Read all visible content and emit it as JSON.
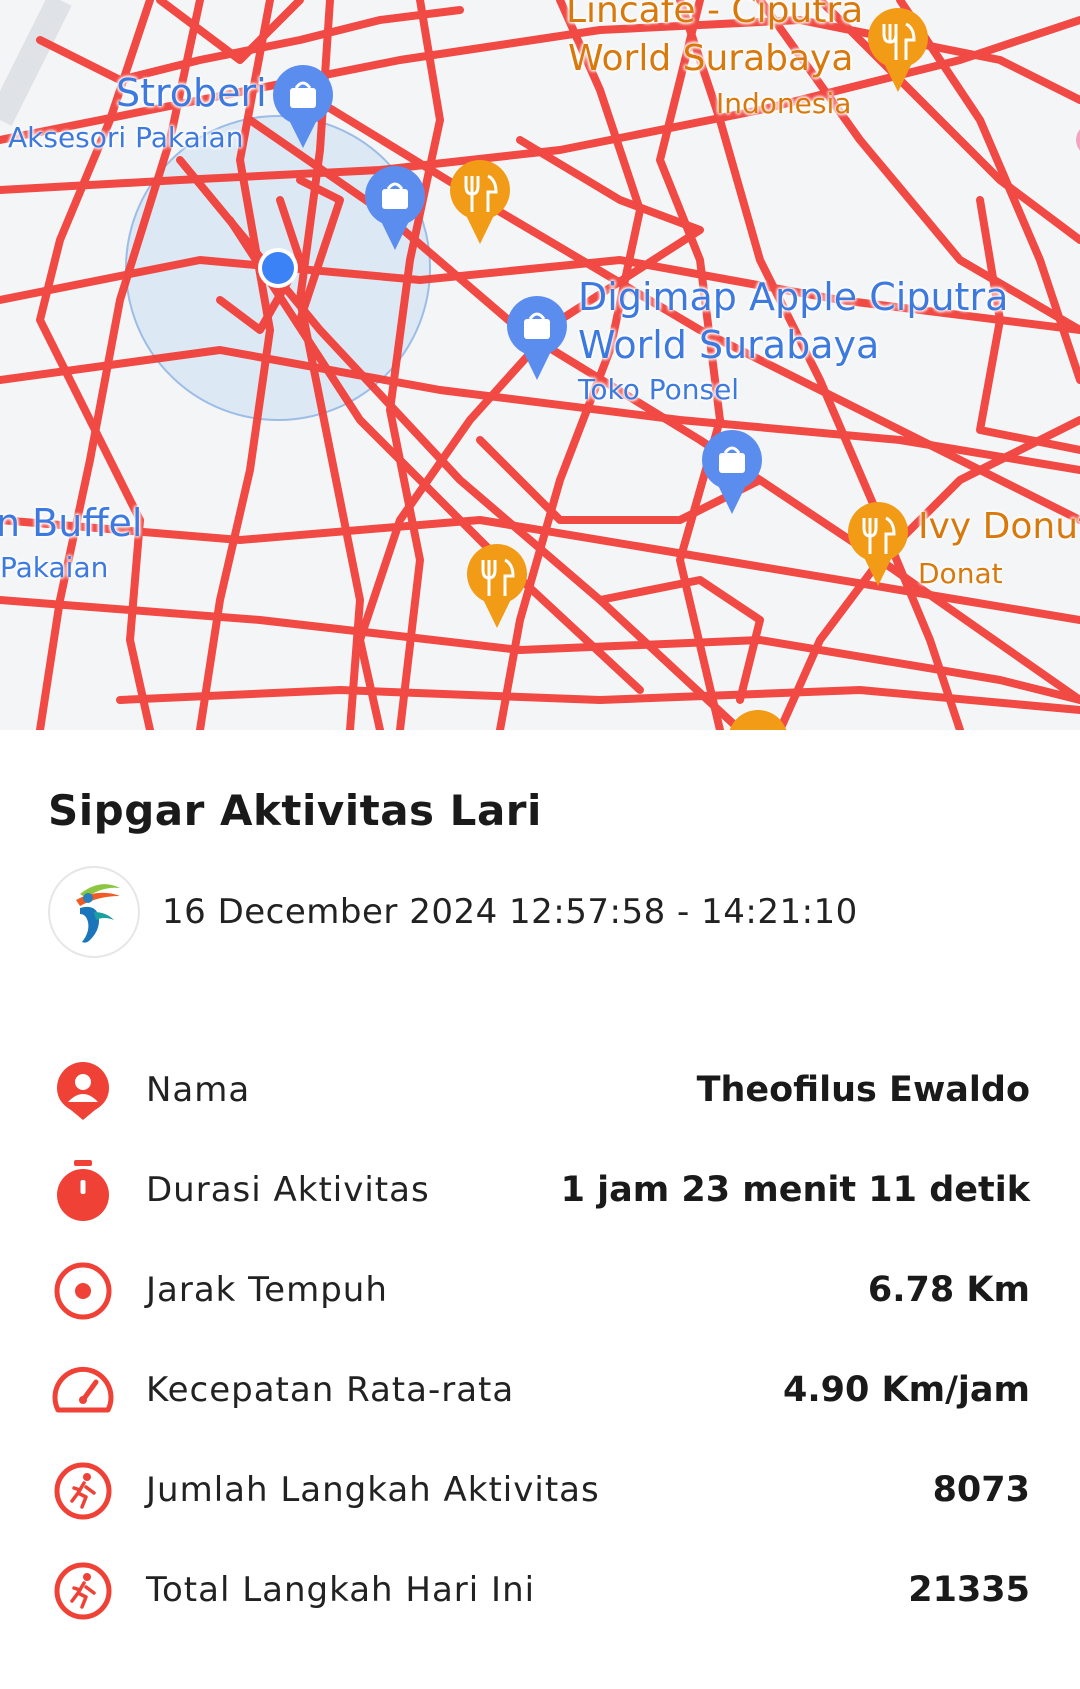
{
  "map": {
    "pois": {
      "stroberi": {
        "name": "Stroberi",
        "category": "Aksesori Pakaian"
      },
      "buffel": {
        "name": "n Buffel",
        "category": "Pakaian"
      },
      "lincafe": {
        "name_line1": "Lincafe - Ciputra",
        "name_line2": "World Surabaya",
        "category": "Indonesia"
      },
      "digimap": {
        "name_line1": "Digimap Apple Ciputra",
        "name_line2": "World Surabaya",
        "category": "Toko Ponsel"
      },
      "ivy": {
        "name": "Ivy Donut",
        "category": "Donat"
      }
    },
    "route_color": "#f1403a",
    "shop_pin_color": "#5b8def",
    "food_pin_color": "#f29b16",
    "location_dot_color": "#3b82f6"
  },
  "activity": {
    "title": "Sipgar Aktivitas Lari",
    "datetime": "16 December 2024 12:57:58 - 14:21:10",
    "rows": [
      {
        "icon": "person-pin-icon",
        "label": "Nama",
        "value": "Theofilus Ewaldo"
      },
      {
        "icon": "stopwatch-icon",
        "label": "Durasi Aktivitas",
        "value": "1 jam 23 menit 11 detik"
      },
      {
        "icon": "target-icon",
        "label": "Jarak Tempuh",
        "value": "6.78 Km"
      },
      {
        "icon": "speedometer-icon",
        "label": "Kecepatan Rata-rata",
        "value": "4.90 Km/jam"
      },
      {
        "icon": "runner-icon",
        "label": "Jumlah Langkah Aktivitas",
        "value": "8073"
      },
      {
        "icon": "runner-icon",
        "label": "Total Langkah Hari Ini",
        "value": "21335"
      }
    ],
    "accent_color": "#ef4136"
  }
}
